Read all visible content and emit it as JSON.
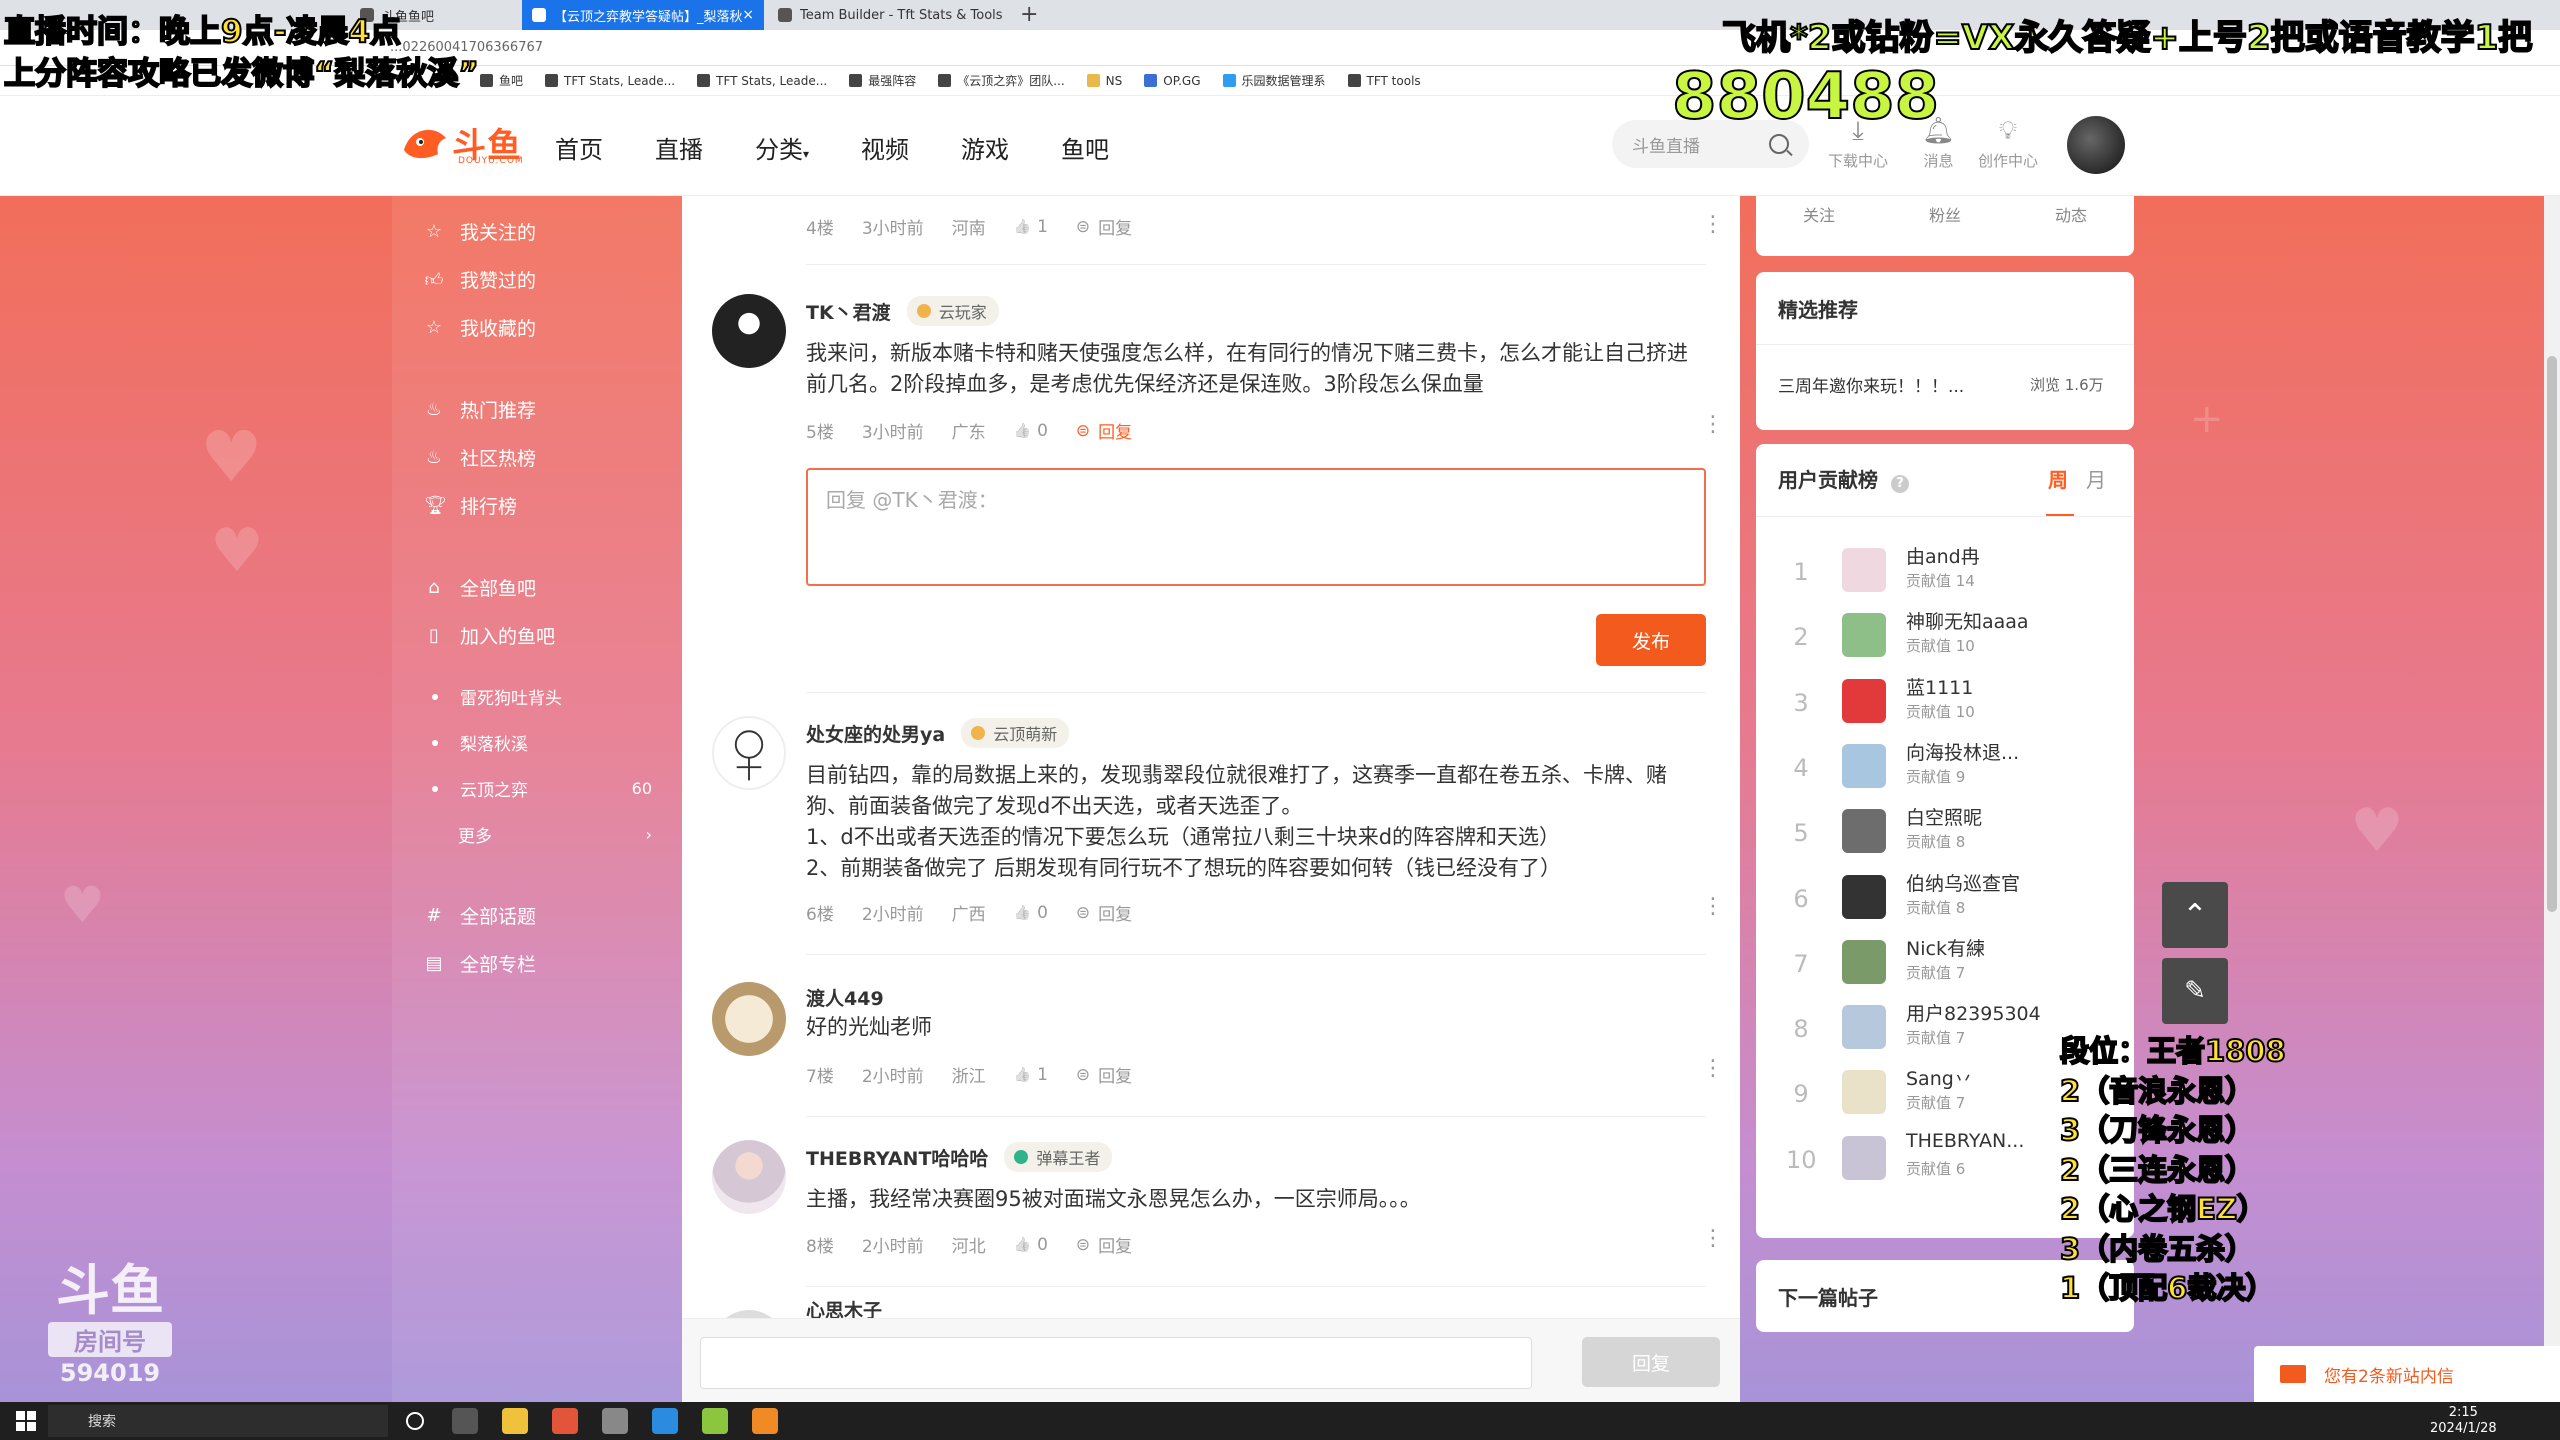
{
  "browser": {
    "tabs": [
      {
        "title": "斗鱼鱼吧"
      },
      {
        "title": "【云顶之弈教学答疑帖】_梨落秋溪..."
      },
      {
        "title": "Team Builder - Tft Stats & Tools"
      }
    ],
    "url": "...02260041706366767",
    "bookmarks": [
      "鱼吧",
      "TFT Stats, Leade...",
      "TFT Stats, Leade...",
      "最强阵容",
      "《云顶之弈》团队...",
      "NS",
      "OP.GG",
      "乐园数据管理系",
      "TFT tools"
    ]
  },
  "header": {
    "logo_text": "斗鱼",
    "logo_sub": "DOUYU.COM",
    "nav": [
      "首页",
      "直播",
      "分类",
      "视频",
      "游戏",
      "鱼吧"
    ],
    "search_placeholder": "斗鱼直播",
    "tools": [
      {
        "icon": "download-icon",
        "label": "下载中心"
      },
      {
        "icon": "bell-icon",
        "label": "消息"
      },
      {
        "icon": "bulb-icon",
        "label": "创作中心"
      }
    ]
  },
  "sidebar": {
    "group1": [
      "我关注的",
      "我赞过的",
      "我收藏的"
    ],
    "group2": [
      "热门推荐",
      "社区热榜",
      "排行榜"
    ],
    "group3": [
      "全部鱼吧",
      "加入的鱼吧"
    ],
    "sub_items": [
      {
        "label": "雷死狗吐背头",
        "count": ""
      },
      {
        "label": "梨落秋溪",
        "count": ""
      },
      {
        "label": "云顶之弈",
        "count": "60"
      },
      {
        "label": "更多",
        "count": "›"
      }
    ],
    "group4": [
      "全部话题",
      "全部专栏"
    ]
  },
  "feed": {
    "row0": {
      "floor": "4楼",
      "time": "3小时前",
      "region": "河南",
      "likes": "1",
      "reply": "回复"
    },
    "comments": [
      {
        "name": "TK丶君渡",
        "badge": "云玩家",
        "text": "我来问，新版本赌卡特和赌天使强度怎么样，在有同行的情况下赌三费卡，怎么才能让自己挤进前几名。2阶段掉血多，是考虑优先保经济还是保连败。3阶段怎么保血量",
        "floor": "5楼",
        "time": "3小时前",
        "region": "广东",
        "likes": "0",
        "reply": "回复"
      },
      {
        "name": "处女座的处男ya",
        "badge": "云顶萌新",
        "text": "目前钻四，靠的局数据上来的，发现翡翠段位就很难打了，这赛季一直都在卷五杀、卡牌、赌狗、前面装备做完了发现d不出天选，或者天选歪了。\n1、d不出或者天选歪的情况下要怎么玩（通常拉八剩三十块来d的阵容牌和天选）\n2、前期装备做完了 后期发现有同行玩不了想玩的阵容要如何转（钱已经没有了）",
        "floor": "6楼",
        "time": "2小时前",
        "region": "广西",
        "likes": "0",
        "reply": "回复"
      },
      {
        "name": "渡人449",
        "badge": "",
        "text": "好的光灿老师",
        "floor": "7楼",
        "time": "2小时前",
        "region": "浙江",
        "likes": "1",
        "reply": "回复"
      },
      {
        "name": "THEBRYANT哈哈哈",
        "badge": "弹幕王者",
        "text": "主播，我经常决赛圈95被对面瑞文永恩晃怎么办，一区宗师局。。。",
        "floor": "8楼",
        "time": "2小时前",
        "region": "河北",
        "likes": "0",
        "reply": "回复"
      },
      {
        "name": "心思木子"
      }
    ],
    "reply_placeholder": "回复 @TK丶君渡：",
    "publish_label": "发布",
    "bottom_reply_label": "回复"
  },
  "right": {
    "stats": [
      "关注",
      "粉丝",
      "动态"
    ],
    "featured_title": "精选推荐",
    "featured_item": "三周年邀你来玩！！！...",
    "featured_views": "浏览 1.6万",
    "contrib_title": "用户贡献榜",
    "tab_week": "周",
    "tab_month": "月",
    "ranks": [
      {
        "n": "1",
        "name": "由and冉",
        "val": "贡献值 14",
        "color": "#f0d8e0"
      },
      {
        "n": "2",
        "name": "神聊无知aaaa",
        "val": "贡献值 10",
        "color": "#8fbf88"
      },
      {
        "n": "3",
        "name": "蓝1111",
        "val": "贡献值 10",
        "color": "#e23a3a"
      },
      {
        "n": "4",
        "name": "向海投林退...",
        "val": "贡献值 9",
        "color": "#a9c6e0"
      },
      {
        "n": "5",
        "name": "白空照昵",
        "val": "贡献值 8",
        "color": "#6d6d6d"
      },
      {
        "n": "6",
        "name": "伯纳乌巡查官",
        "val": "贡献值 8",
        "color": "#333333"
      },
      {
        "n": "7",
        "name": "Nick有練",
        "val": "贡献值 7",
        "color": "#7a9a6a"
      },
      {
        "n": "8",
        "name": "用户82395304",
        "val": "贡献值 7",
        "color": "#b6c8dc"
      },
      {
        "n": "9",
        "name": "Sang丷",
        "val": "贡献值 7",
        "color": "#e9e2c9"
      },
      {
        "n": "10",
        "name": "THEBRYAN...",
        "val": "贡献值 6",
        "color": "#c9c3d6"
      }
    ],
    "next_post": "下一篇帖子",
    "message_toast": "您有2条新站内信"
  },
  "overlay": {
    "line1": "直播时间：晚上9点-凌晨4点",
    "line2": "上分阵容攻略已发微博“梨落秋溪”",
    "promo": "飞机*2或钻粉=VX永久答疑+上号2把或语音教学1把",
    "number": "880488",
    "rank_lines": [
      "段位：王者1808",
      "2（音浪永恩）",
      "3（刀锋永恩）",
      "2（三连永恩）",
      "2（心之钢EZ）",
      "3（内卷五杀）",
      "1（顶配6裁决）"
    ],
    "watermark_logo": "斗鱼",
    "watermark_label": "房间号",
    "watermark_room": "594019"
  },
  "taskbar": {
    "search": "搜索",
    "time": "2:15",
    "date": "2024/1/28"
  }
}
